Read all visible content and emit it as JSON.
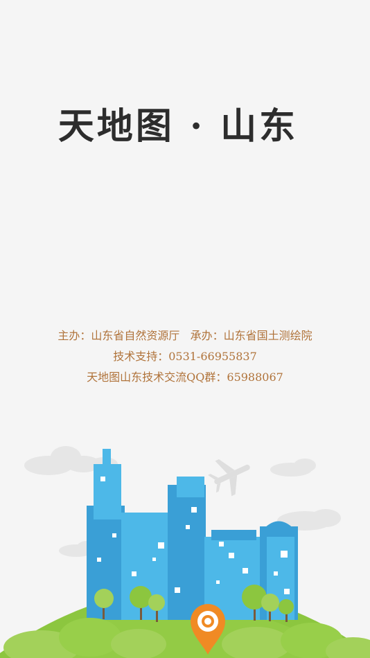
{
  "app": {
    "title": "天地图 · 山东"
  },
  "credits": {
    "line1_host": "主办：山东省自然资源厅",
    "line1_organizer": "承办：山东省国土测绘院",
    "line2_support": "技术支持：0531-66955837",
    "line3_qq": "天地图山东技术交流QQ群：65988067"
  },
  "colors": {
    "background": "#f5f5f5",
    "title": "#2d2d2d",
    "credits_text": "#b0733a",
    "building_blue": "#4db8e8",
    "building_dark": "#3a9fd6",
    "hill_green": "#8cc63f",
    "tree_green": "#a3d15a",
    "pin_orange": "#f08a24"
  },
  "icons": {
    "location_pin": "location-pin-icon",
    "airplane": "airplane-icon"
  }
}
